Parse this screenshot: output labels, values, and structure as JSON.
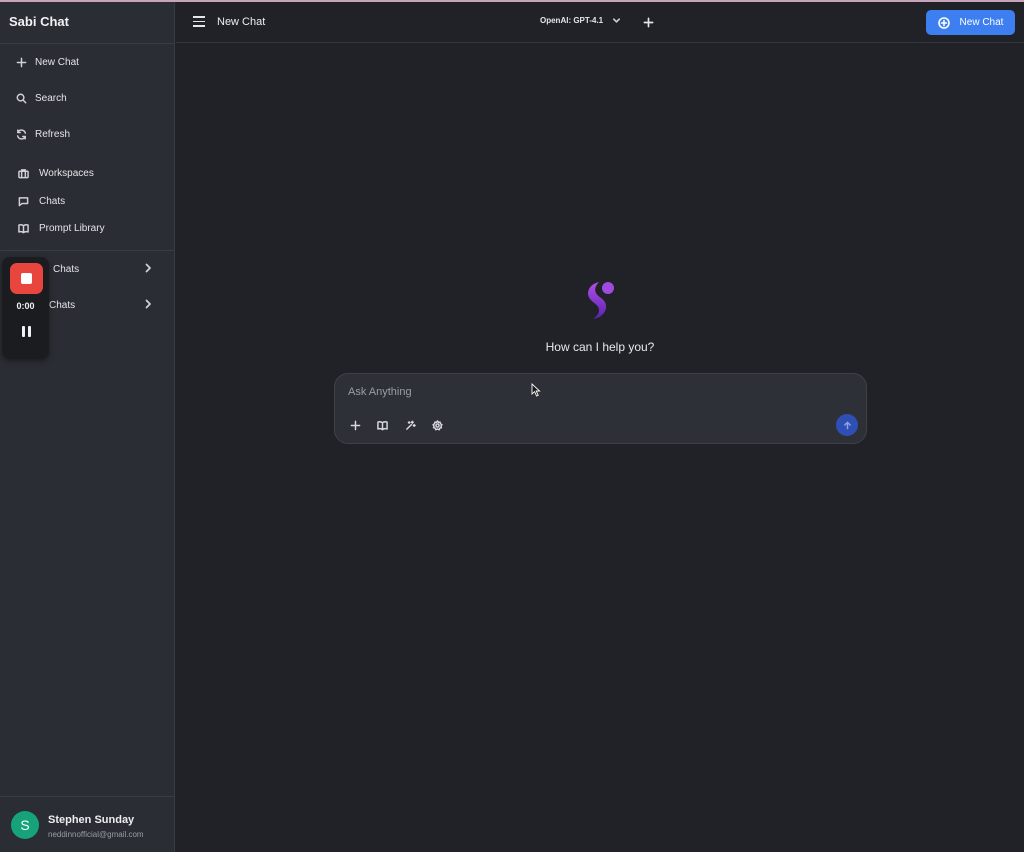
{
  "app": {
    "title": "Sabi Chat"
  },
  "sidebar": {
    "actions": [
      {
        "label": "New Chat",
        "icon": "plus-icon"
      },
      {
        "label": "Search",
        "icon": "search-icon"
      },
      {
        "label": "Refresh",
        "icon": "refresh-icon"
      }
    ],
    "nav": [
      {
        "label": "Workspaces",
        "icon": "briefcase-icon"
      },
      {
        "label": "Chats",
        "icon": "chat-bubble-icon"
      },
      {
        "label": "Prompt Library",
        "icon": "book-icon"
      }
    ],
    "sections": [
      {
        "label": "Chats",
        "icon": "chevron-right-icon"
      },
      {
        "label": "Chats",
        "icon": "chevron-right-icon"
      }
    ]
  },
  "recorder": {
    "time": "0:00"
  },
  "user": {
    "initial": "S",
    "name": "Stephen Sunday",
    "email": "neddinnofficial@gmail.com"
  },
  "header": {
    "title": "New Chat",
    "model": "OpenAI: GPT-4.1",
    "new_chat_label": "New Chat"
  },
  "main": {
    "greeting": "How can I help you?",
    "input_placeholder": "Ask Anything",
    "input_value": ""
  },
  "colors": {
    "background": "#212228",
    "sidebar": "#2b2d34",
    "accent": "#3d7ff0",
    "record": "#e9453f",
    "avatar": "#16a37a",
    "logo": "#8b3fd6"
  }
}
